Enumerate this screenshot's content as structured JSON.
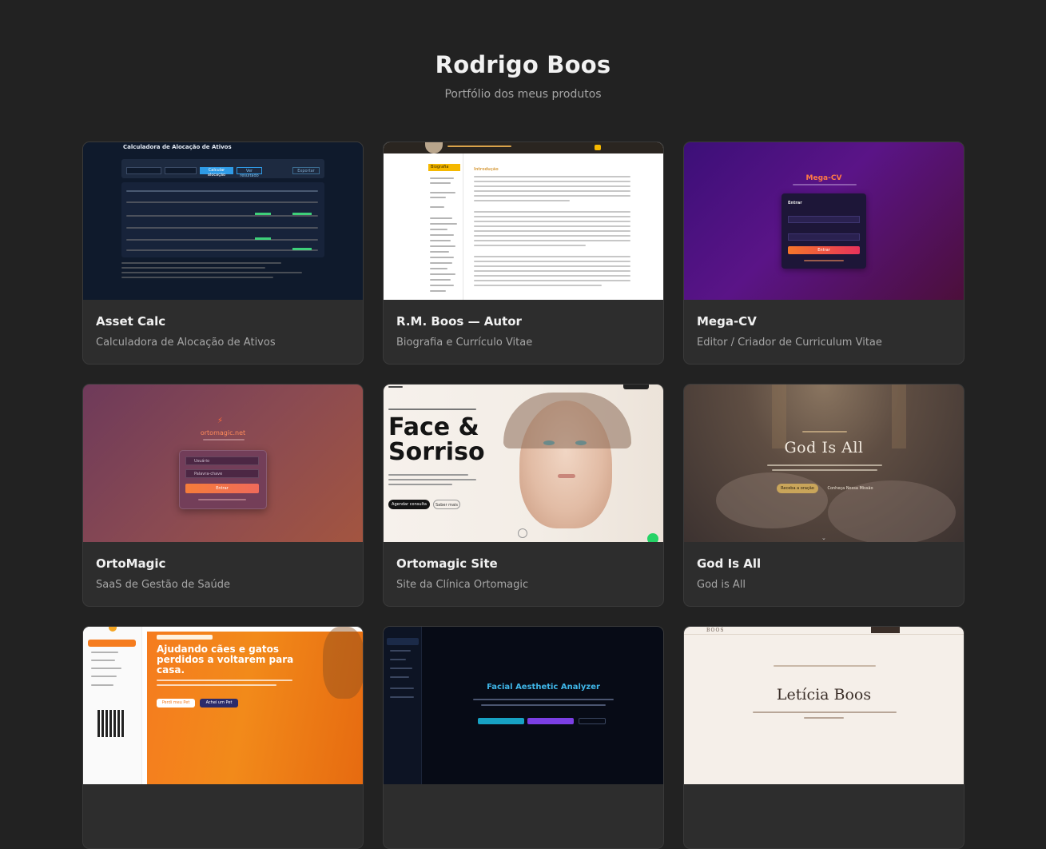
{
  "header": {
    "title": "Rodrigo Boos",
    "subtitle": "Portfólio dos meus produtos"
  },
  "cards": [
    {
      "title": "Asset Calc",
      "description": "Calculadora de Alocação de Ativos",
      "preview": {
        "heading": "Calculadora de Alocação de Ativos",
        "btn_primary": "Calcular alocação",
        "btn_secondary": "Ver resultado",
        "btn_tertiary": "Exportar"
      }
    },
    {
      "title": "R.M. Boos — Autor",
      "description": "Biografia e Currículo Vitae",
      "preview": {
        "nav_active": "Biografia",
        "section_heading": "Introdução"
      }
    },
    {
      "title": "Mega-CV",
      "description": "Editor / Criador de Curriculum Vitae",
      "preview": {
        "brand": "Mega-CV",
        "login_title": "Entrar",
        "button": "Entrar"
      }
    },
    {
      "title": "OrtoMagic",
      "description": "SaaS de Gestão de Saúde",
      "preview": {
        "brand": "ortomagic.net",
        "user_placeholder": "Usuário",
        "password_placeholder": "Palavra-chave",
        "button": "Entrar"
      }
    },
    {
      "title": "Ortomagic Site",
      "description": "Site da Clínica Ortomagic",
      "preview": {
        "headline_1": "Face &",
        "headline_2": "Sorriso",
        "cta_primary": "Agendar consulta",
        "cta_secondary": "Saber mais"
      }
    },
    {
      "title": "God Is All",
      "description": "God is All",
      "preview": {
        "headline": "God Is All",
        "cta_primary": "Receba a oração",
        "cta_secondary": "Conheça Nossa Missão"
      }
    },
    {
      "title": "",
      "description": "",
      "preview": {
        "headline": "Ajudando cães e gatos perdidos a voltarem para casa.",
        "btn_lost": "Perdi meu Pet",
        "btn_found": "Achei um Pet"
      }
    },
    {
      "title": "",
      "description": "",
      "preview": {
        "headline": "Facial Aesthetic Analyzer"
      }
    },
    {
      "title": "",
      "description": "",
      "preview": {
        "brand": "BOOS",
        "headline": "Letícia Boos"
      }
    }
  ],
  "colors": {
    "page_bg": "#222222",
    "card_bg": "#2d2d2d",
    "accent_orange": "#f57c1f",
    "accent_blue": "#2f9be6"
  }
}
